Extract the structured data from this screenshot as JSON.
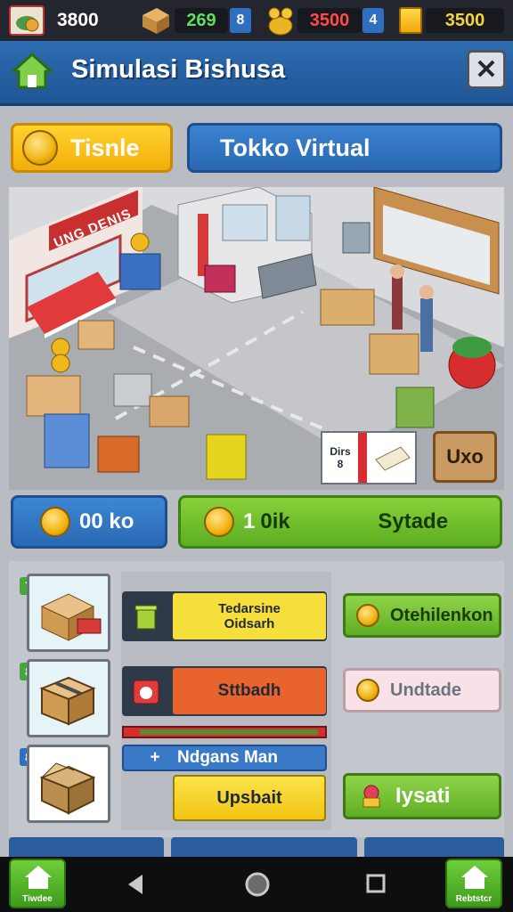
{
  "resources": {
    "player_level_value": "3800",
    "crates_value": "269",
    "gold_value": "3500",
    "cash_value": "3500",
    "plus_label_1": "8",
    "plus_label_2": "4"
  },
  "header": {
    "title": "Simulasi Bishusa",
    "close_label": "✕"
  },
  "tabs": [
    {
      "label": "Tisnle"
    },
    {
      "label": "Tokko Virtual"
    }
  ],
  "scene": {
    "shop_sign": "UNG DENIS",
    "badge_label": "Dirs",
    "badge_sub": "8",
    "upgrade_chip": "Uxo"
  },
  "summary": {
    "left_label": "00 ko",
    "right_value": "1",
    "right_unit": "0ik",
    "right_label": "Sytade"
  },
  "items": [
    {
      "number": "7",
      "label_line1": "Tedarsine",
      "label_line2": "Oidsarh",
      "action": "Otehilenkon"
    },
    {
      "number": "8",
      "label_line1": "Sttbadh",
      "action": "Undtade"
    },
    {
      "number": "8",
      "header_label": "Ndgans Man",
      "header_plus": "+",
      "label_line1": "Upsbait",
      "action": "Iysati"
    }
  ],
  "nav": {
    "left_label": "Tiwdee",
    "right_label": "Rebtstcr"
  },
  "colors": {
    "header_blue": "#2a64a8",
    "accent_yellow": "#f5c518",
    "accent_green": "#6cc22f",
    "accent_orange": "#e8642c"
  }
}
